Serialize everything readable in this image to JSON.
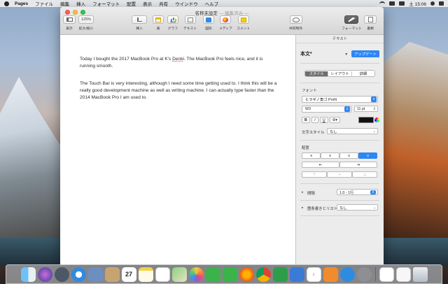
{
  "menubar": {
    "app_name": "Pages",
    "items": [
      "ファイル",
      "編集",
      "挿入",
      "フォーマット",
      "配置",
      "表示",
      "共有",
      "ウインドウ",
      "ヘルプ"
    ],
    "clock": "土 15:06"
  },
  "window": {
    "title": "名称未設定",
    "subtitle": "— 編集済み —"
  },
  "toolbar": {
    "view_label": "表示",
    "zoom_value": "125%",
    "zoom_label": "拡大/縮小",
    "insert_label": "挿入",
    "table_label": "表",
    "chart_label": "グラフ",
    "text_label": "テキスト",
    "shape_label": "図形",
    "media_label": "メディア",
    "comment_label": "コメント",
    "collaborate_label": "共同制作",
    "format_label": "フォーマット",
    "document_label": "書類"
  },
  "document": {
    "p1_a": "Today I bought the 2017 MacBook Pro at K's ",
    "p1_spell": "Denki",
    "p1_b": ". The MacBook Pro feels nice, and it is running smooth.",
    "p2": "The Touch Bar is very interesting, although I need some time getting used to. I think this will be a really good development machine as well as writing machine. I can actually type faster than the 2014 MacBook Pro I am used to."
  },
  "inspector": {
    "header": "テキスト",
    "paragraph_style": "本文*",
    "update_button": "アップデート",
    "tabs": [
      "スタイル",
      "レイアウト",
      "詳細"
    ],
    "font_section": "フォント",
    "font_family": "ヒラギノ角ゴ ProN",
    "font_weight": "W3",
    "font_size": "11 pt",
    "style_buttons": [
      "B",
      "I",
      "U"
    ],
    "char_style_label": "文字スタイル",
    "char_style_value": "なし",
    "alignment_section": "配置",
    "spacing_label": "間隔",
    "spacing_value": "1.0 - 1行",
    "bullets_label": "箇条書きとリスト",
    "bullets_value": "なし"
  },
  "dock": {
    "apps": [
      "Finder",
      "Siri",
      "Launchpad",
      "Safari",
      "Mail",
      "Contacts",
      "Calendar",
      "Notes",
      "Reminders",
      "Maps",
      "Photos",
      "Messages",
      "FaceTime",
      "Firefox",
      "Chrome",
      "Numbers",
      "Keynote",
      "Music",
      "Books",
      "App Store",
      "System Preferences",
      "Pages",
      "Preview",
      "Trash"
    ],
    "calendar_day": "27"
  },
  "colors": {
    "accent_blue": "#2e86f5",
    "close": "#fc605b",
    "minimize": "#fdbc40",
    "maximize": "#34c84a"
  }
}
